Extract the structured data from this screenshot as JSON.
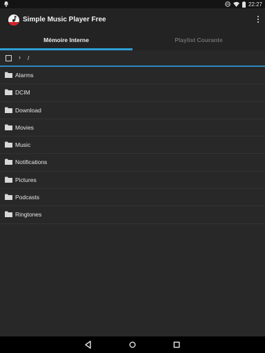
{
  "status": {
    "time": "22:27"
  },
  "app": {
    "title": "Simple Music Player Free"
  },
  "tabs": [
    {
      "label": "Mémoire Interne"
    },
    {
      "label": "Playlist Courante"
    }
  ],
  "path": {
    "current": "/"
  },
  "folders": [
    {
      "label": "Alarms"
    },
    {
      "label": "DCIM"
    },
    {
      "label": "Download"
    },
    {
      "label": "Movies"
    },
    {
      "label": "Music"
    },
    {
      "label": "Notifications"
    },
    {
      "label": "Pictures"
    },
    {
      "label": "Podcasts"
    },
    {
      "label": "Ringtones"
    }
  ],
  "colors": {
    "accent": "#2ea0d6",
    "background": "#282828",
    "toolbar": "#232323"
  }
}
